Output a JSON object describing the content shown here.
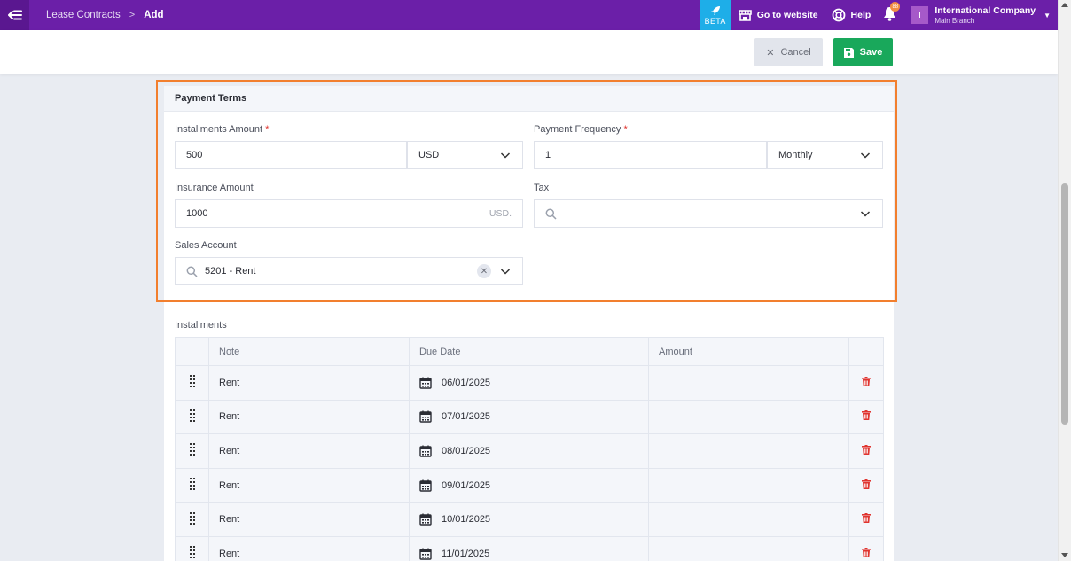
{
  "topbar": {
    "breadcrumb": {
      "parent": "Lease Contracts",
      "separator": ">",
      "current": "Add"
    },
    "beta_label": "BETA",
    "goto_website": "Go to website",
    "help": "Help",
    "notification_count": "88",
    "company": {
      "avatar_letter": "I",
      "name": "International Company",
      "branch": "Main Branch"
    }
  },
  "actions": {
    "cancel": "Cancel",
    "save": "Save"
  },
  "payment_terms": {
    "title": "Payment Terms",
    "installments_amount": {
      "label": "Installments Amount",
      "required_mark": "*",
      "value": "500",
      "currency": "USD"
    },
    "payment_frequency": {
      "label": "Payment Frequency",
      "required_mark": "*",
      "value": "1",
      "period": "Monthly"
    },
    "insurance_amount": {
      "label": "Insurance Amount",
      "value": "1000",
      "suffix": "USD."
    },
    "tax": {
      "label": "Tax",
      "value": ""
    },
    "sales_account": {
      "label": "Sales Account",
      "value": "5201 - Rent"
    }
  },
  "installments": {
    "label": "Installments",
    "columns": [
      "Note",
      "Due Date",
      "Amount"
    ],
    "rows": [
      {
        "note": "Rent",
        "due_date": "06/01/2025",
        "amount": ""
      },
      {
        "note": "Rent",
        "due_date": "07/01/2025",
        "amount": ""
      },
      {
        "note": "Rent",
        "due_date": "08/01/2025",
        "amount": ""
      },
      {
        "note": "Rent",
        "due_date": "09/01/2025",
        "amount": ""
      },
      {
        "note": "Rent",
        "due_date": "10/01/2025",
        "amount": ""
      },
      {
        "note": "Rent",
        "due_date": "11/01/2025",
        "amount": ""
      }
    ]
  },
  "colors": {
    "topbar": "#6b1fa8",
    "beta": "#1eaee8",
    "save": "#19a85b",
    "highlight": "#f27f2e",
    "delete": "#e0342f"
  }
}
